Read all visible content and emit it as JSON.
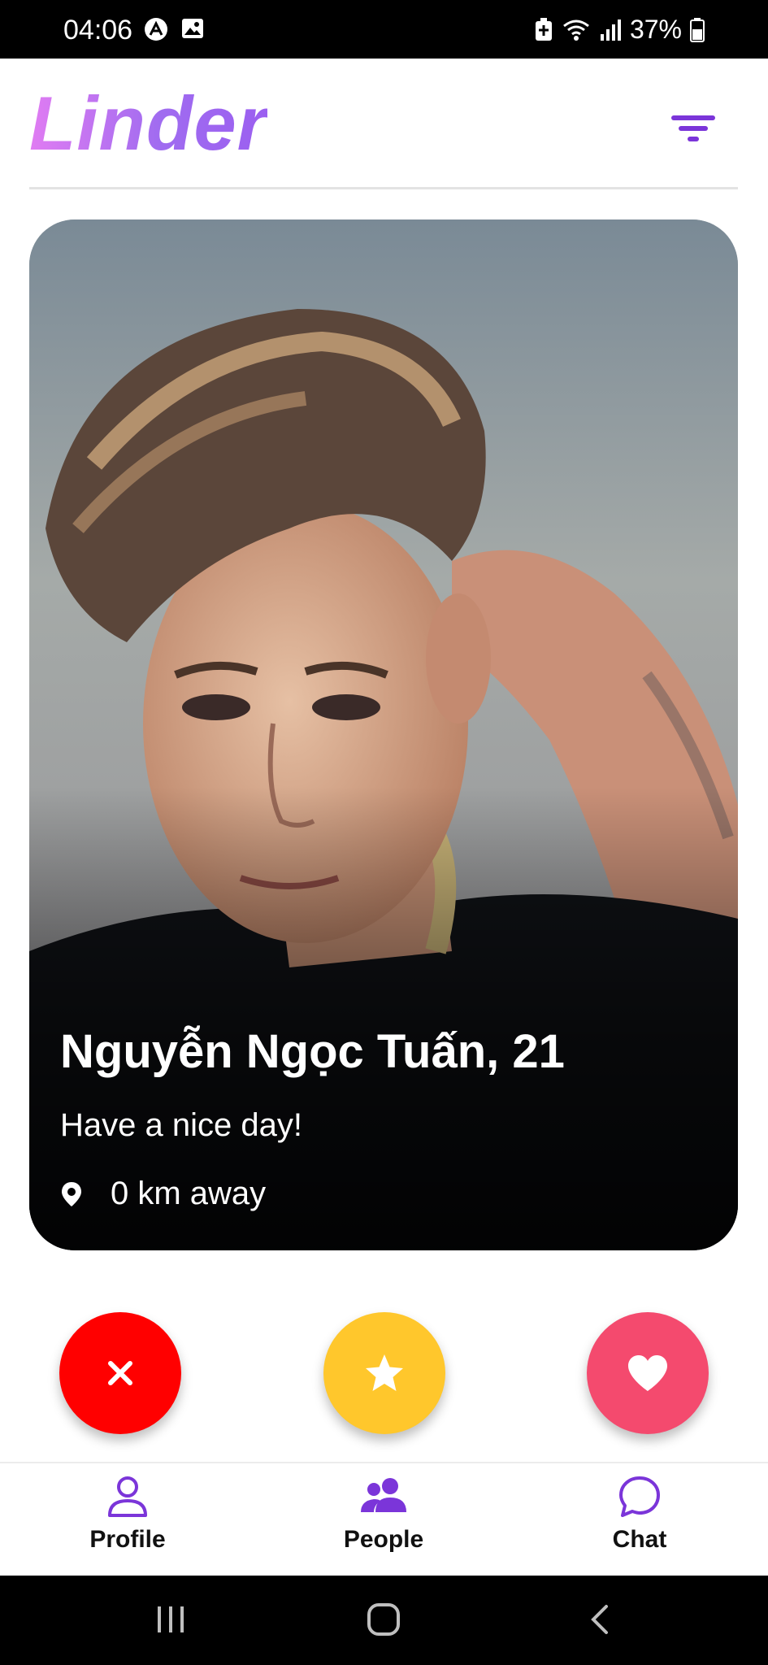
{
  "status_bar": {
    "time": "04:06",
    "battery": "37%",
    "icons": [
      "a-icon",
      "image-icon",
      "battery-saver-icon",
      "wifi-icon",
      "signal-icon",
      "battery-icon"
    ]
  },
  "header": {
    "logo": "Linder",
    "filter_icon": "filter-icon"
  },
  "card": {
    "name_age": "Nguyễn Ngọc Tuấn, 21",
    "bio": "Have a nice day!",
    "distance": "0 km away",
    "location_icon": "location-pin-icon"
  },
  "actions": [
    {
      "icon": "close-icon",
      "color": "#ff0000"
    },
    {
      "icon": "star-icon",
      "color": "#ffc72c"
    },
    {
      "icon": "heart-icon",
      "color": "#f44a6e"
    }
  ],
  "bottom_nav": {
    "items": [
      {
        "label": "Profile",
        "icon": "user-icon"
      },
      {
        "label": "People",
        "icon": "people-icon"
      },
      {
        "label": "Chat",
        "icon": "chat-bubble-icon"
      }
    ],
    "accent": "#7b35d9"
  },
  "colors": {
    "logo_gradient_start": "#e07cf2",
    "logo_gradient_end": "#9b5ff0",
    "accent": "#7b35d9"
  }
}
